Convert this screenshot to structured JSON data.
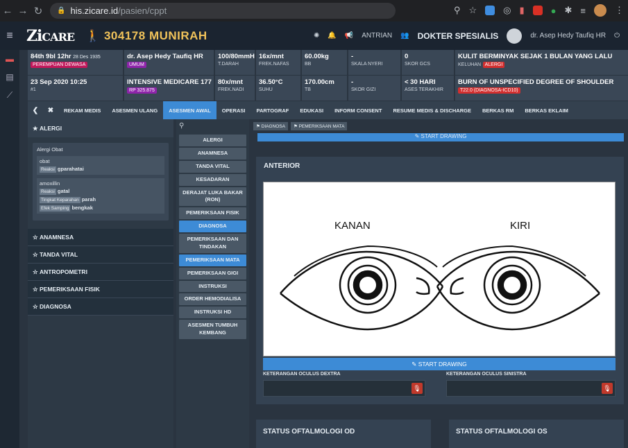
{
  "browser": {
    "url_host": "his.zicare.id",
    "url_path": "/pasien/cppt"
  },
  "header": {
    "logo_main": "Zi",
    "logo_rest": "CARE",
    "patient_id": "304178",
    "patient_name": "MUNIRAH",
    "antrian": "ANTRIAN",
    "role": "DOKTER SPESIALIS",
    "user": "dr. Asep Hedy Taufiq HR"
  },
  "info_row1": [
    {
      "big": "84th 9bl 12hr",
      "extra": "28 Des 1935",
      "tag": "PEREMPUAN DEWASA"
    },
    {
      "big": "dr. Asep Hedy Taufiq HR",
      "tag": "UMUM"
    },
    {
      "big": "100/80mmHg",
      "sub": "T.DARAH"
    },
    {
      "big": "16x/mnt",
      "sub": "FREK.NAFAS"
    },
    {
      "big": "60.00kg",
      "sub": "BB"
    },
    {
      "big": "-",
      "sub": "SKALA NYERI"
    },
    {
      "big": "0",
      "sub": "SKOR GCS"
    },
    {
      "big": "KULIT BERMINYAK SEJAK 1 BULAN YANG LALU",
      "sub": "KELUHAN",
      "tag": "ALERGI"
    }
  ],
  "info_row2": [
    {
      "big": "23 Sep 2020 10:25",
      "sub": "#1"
    },
    {
      "big": "INTENSIVE MEDICARE 177 - I",
      "tag": "RP 325.875"
    },
    {
      "big": "80x/mnt",
      "sub": "FREK.NADI"
    },
    {
      "big": "36.50°C",
      "sub": "SUHU"
    },
    {
      "big": "170.00cm",
      "sub": "TB"
    },
    {
      "big": "-",
      "sub": "SKOR GIZI"
    },
    {
      "big": "< 30 HARI",
      "sub": "ASES TERAKHIR"
    },
    {
      "big": "BURN OF UNSPECIFIED DEGREE OF SHOULDER",
      "tag": "T22.0 (DIAGNOSA-ICD10)"
    }
  ],
  "tabs": [
    "REKAM MEDIS",
    "ASESMEN ULANG",
    "ASESMEN AWAL",
    "OPERASI",
    "PARTOGRAF",
    "EDUKASI",
    "INFORM CONSENT",
    "RESUME MEDIS & DISCHARGE",
    "BERKAS RM",
    "BERKAS EKLAIM"
  ],
  "left": {
    "header": "ALERGI",
    "box_title": "Alergi Obat",
    "a1_name": "obat",
    "a1_reaksi_lbl": "Reaksi",
    "a1_reaksi": "gparahatai",
    "a2_name": "amoxillin",
    "a2_reaksi_lbl": "Reaksi",
    "a2_reaksi": "gatal",
    "a2_tingkat_lbl": "Tingkat Keparahan",
    "a2_tingkat": "parah",
    "a2_efek_lbl": "Efek Samping",
    "a2_efek": "bengkak",
    "sections": [
      "ANAMNESA",
      "TANDA VITAL",
      "ANTROPOMETRI",
      "PEMERIKSAAN FISIK",
      "DIAGNOSA"
    ]
  },
  "menu": [
    "ALERGI",
    "ANAMNESA",
    "TANDA VITAL",
    "KESADARAN",
    "DERAJAT LUKA BAKAR (RON)",
    "PEMERIKSAAN FISIK",
    "DIAGNOSA",
    "PEMERIKSAAN DAN TINDAKAN",
    "PEMERIKSAAN MATA",
    "PEMERIKSAAN GIGI",
    "INSTRUKSI",
    "ORDER HEMODIALISA",
    "INSTRUKSI HD",
    "ASESMEN TUMBUH KEMBANG"
  ],
  "main": {
    "crumb1": "DIAGNOSA",
    "crumb2": "PEMERIKSAAN MATA",
    "top_draw": "START DRAWING",
    "card_title": "ANTERIOR",
    "kanan": "KANAN",
    "kiri": "KIRI",
    "draw": "START DRAWING",
    "od_label": "KETERANGAN OCULUS DEXTRA",
    "os_label": "KETERANGAN OCULUS SINISTRA",
    "status_od": "STATUS OFTALMOLOGI OD",
    "status_os": "STATUS OFTALMOLOGI OS"
  },
  "colors": {
    "accent": "#3d8bd6",
    "patient": "#f0c25a",
    "danger": "#d32f2f"
  }
}
